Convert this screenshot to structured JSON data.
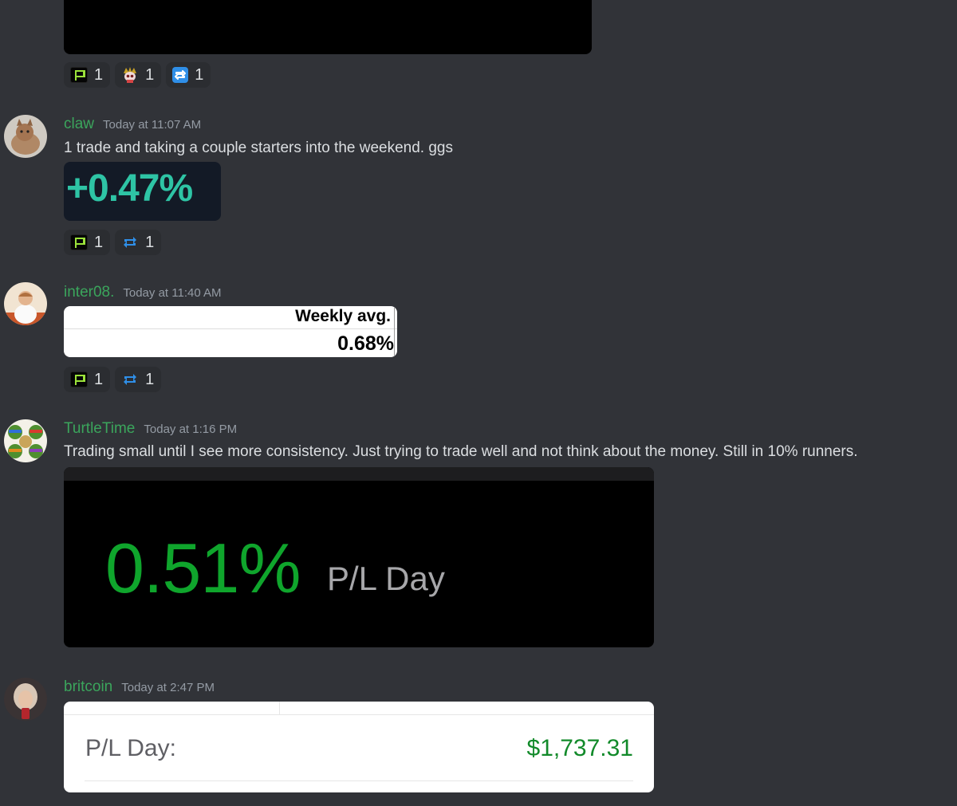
{
  "reactions_top": [
    {
      "icon": "p-logo-icon",
      "count": "1"
    },
    {
      "icon": "skull-icon",
      "count": "1"
    },
    {
      "icon": "repeat-icon",
      "count": "1"
    }
  ],
  "messages": [
    {
      "username": "claw",
      "timestamp": "Today at 11:07 AM",
      "text": "1 trade and taking a couple starters into the weekend. ggs",
      "image_text": "+0.47%",
      "reactions": [
        {
          "icon": "p-logo-icon",
          "count": "1"
        },
        {
          "icon": "repeat-icon",
          "count": "1"
        }
      ]
    },
    {
      "username": "inter08.",
      "timestamp": "Today at 11:40 AM",
      "image_label": "Weekly avg.",
      "image_value": "0.68%",
      "reactions": [
        {
          "icon": "p-logo-icon",
          "count": "1"
        },
        {
          "icon": "repeat-icon",
          "count": "1"
        }
      ]
    },
    {
      "username": "TurtleTime",
      "timestamp": "Today at 1:16 PM",
      "text": "Trading small until I see more consistency.  Just trying to trade well and not think about the money.  Still in 10% runners.",
      "image_value": "0.51%",
      "image_label": "P/L Day"
    },
    {
      "username": "britcoin",
      "timestamp": "Today at 2:47 PM",
      "image_label": "P/L Day:",
      "image_value": "$1,737.31"
    }
  ],
  "colors": {
    "background": "#313338",
    "username": "#3ba55c",
    "timestamp": "#949ba4",
    "reaction_bg": "#2b2d31"
  }
}
